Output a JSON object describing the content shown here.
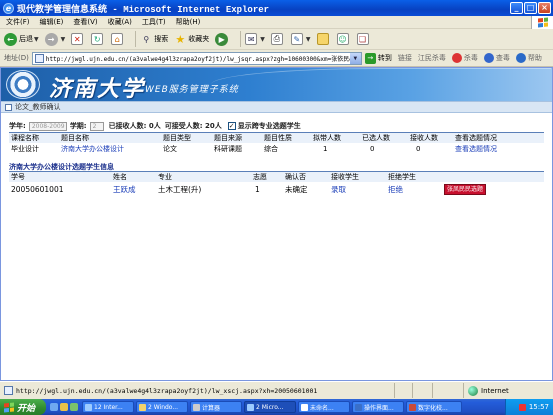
{
  "window": {
    "title": "现代教学管理信息系统 - Microsoft Internet Explorer",
    "buttons": [
      "_",
      "□",
      "×"
    ]
  },
  "menu": [
    "文件(F)",
    "编辑(E)",
    "查看(V)",
    "收藏(A)",
    "工具(T)",
    "帮助(H)"
  ],
  "toolbar": {
    "back_label": "后退",
    "search_label": "搜索",
    "favorites_label": "收藏夹"
  },
  "address": {
    "label": "地址(D)",
    "url": "http://jwgl.ujn.edu.cn/(a3valwe4g4l3zrapa2oyf2jt)/lw_jsqr.aspx?zgh=10600300&xm=张依民&gnm",
    "go_label": "转到",
    "links_label": "链接",
    "ext1": "江民杀毒",
    "ext2": "杀毒",
    "ext3": "查毒",
    "help": "帮助"
  },
  "banner": {
    "univ_name": "济南大学",
    "system_name": "WEB服务管理子系统"
  },
  "breadcrumb": "论文_教师确认",
  "filter": {
    "year_label": "学年:",
    "year_value": "2008-2009",
    "term_label": "学期:",
    "term_value": "2",
    "accepted_text": "已接收人数: 0人",
    "capacity_text": "可接受人数: 20人",
    "checkbox_label": "显示跨专业选题学生",
    "checked": true
  },
  "topics_table": {
    "headers": [
      "课程名称",
      "题目名称",
      "题目类型",
      "题目来源",
      "题目性质",
      "拟带人数",
      "已选人数",
      "接收人数",
      "查看选题情况"
    ],
    "rows": [
      [
        "毕业设计",
        "济南大学办公楼设计",
        "论文",
        "科研课题",
        "综合",
        "1",
        "0",
        "0",
        "查看选题情况"
      ]
    ]
  },
  "students_section_title": "济南大学办公楼设计选题学生信息",
  "students_table": {
    "headers": [
      "学号",
      "姓名",
      "专业",
      "志愿",
      "确认否",
      "接收学生",
      "拒绝学生",
      ""
    ],
    "rows": [
      [
        "20050601001",
        "王跃成",
        "土木工程(升)",
        "1",
        "未确定",
        "录取",
        "拒绝",
        "张凤民民选题"
      ]
    ]
  },
  "status": {
    "url": "http://jwgl.ujn.edu.cn/(a3valwe4g4l3zrapa2oyf2jt)/lw_xscj.aspx?xh=20050601001",
    "zone": "Internet"
  },
  "taskbar": {
    "start_label": "开始",
    "tasks": [
      "12 Inter...",
      "2 Windo...",
      "计算器",
      "2 Micro...",
      "未命名...",
      "操作界面...",
      "数字化校..."
    ],
    "clock": "15:57"
  },
  "colors": {
    "title_blue": "#0A5FE8",
    "link_blue": "#1A3DB8",
    "table_header": "#EAF1FA",
    "banner_blue": "#1E5FA8",
    "red_button": "#C8102E"
  }
}
